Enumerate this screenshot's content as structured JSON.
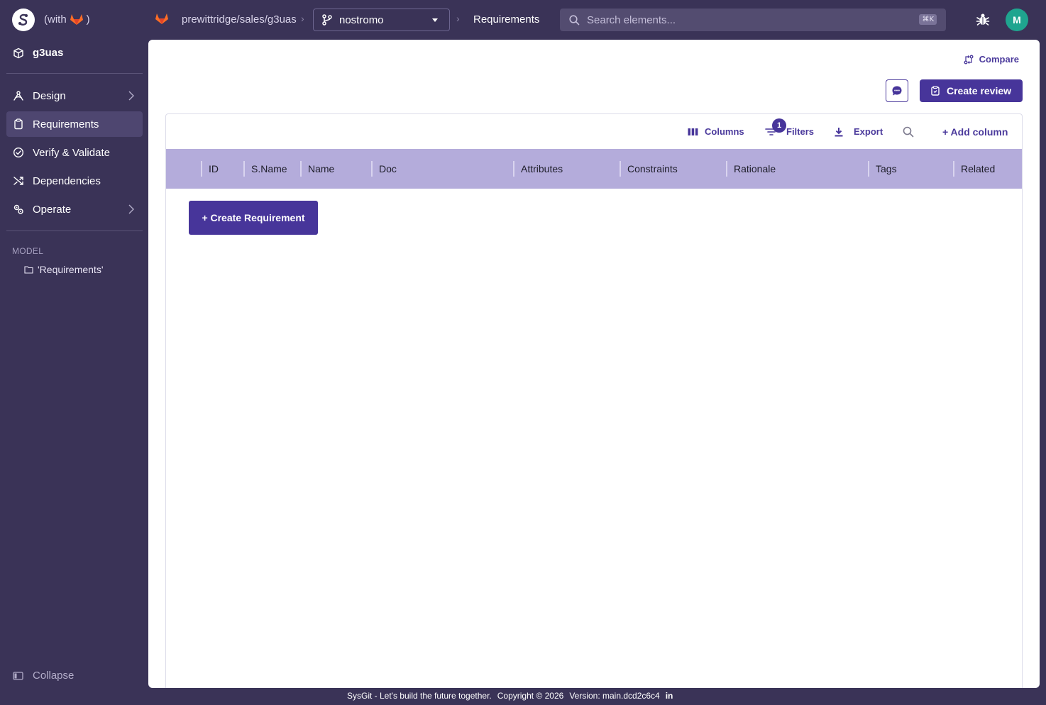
{
  "topbar": {
    "with_prefix": "(with",
    "with_suffix": ")",
    "repo_path": "prewittridge/sales/g3uas",
    "branch": "nostromo",
    "page": "Requirements",
    "search_placeholder": "Search elements...",
    "search_shortcut": "⌘K",
    "avatar_initial": "M"
  },
  "sidebar": {
    "project": "g3uas",
    "items": [
      {
        "label": "Design",
        "icon": "design-icon",
        "has_submenu": true
      },
      {
        "label": "Requirements",
        "icon": "clipboard-icon",
        "active": true
      },
      {
        "label": "Verify & Validate",
        "icon": "check-circle-icon"
      },
      {
        "label": "Dependencies",
        "icon": "shuffle-icon"
      },
      {
        "label": "Operate",
        "icon": "cogs-icon",
        "has_submenu": true
      }
    ],
    "model_heading": "MODEL",
    "model_item": "'Requirements'",
    "collapse_label": "Collapse"
  },
  "main": {
    "compare_label": "Compare",
    "create_review_label": "Create review",
    "toolbar": {
      "columns_label": "Columns",
      "filters_label": "Filters",
      "filters_count": "1",
      "export_label": "Export",
      "add_column_label": "+ Add column"
    },
    "columns": [
      "ID",
      "S.Name",
      "Name",
      "Doc",
      "Attributes",
      "Constraints",
      "Rationale",
      "Tags",
      "Related"
    ],
    "create_requirement_label": "+ Create Requirement"
  },
  "footer": {
    "tagline": "SysGit - Let's build the future together.",
    "copyright": "Copyright © 2026",
    "version": "Version: main.dcd2c6c4",
    "linkedin": "in"
  },
  "colors": {
    "background": "#3a3357",
    "accent": "#47359a",
    "table_header": "#b4acdb",
    "avatar": "#1fa58f"
  }
}
